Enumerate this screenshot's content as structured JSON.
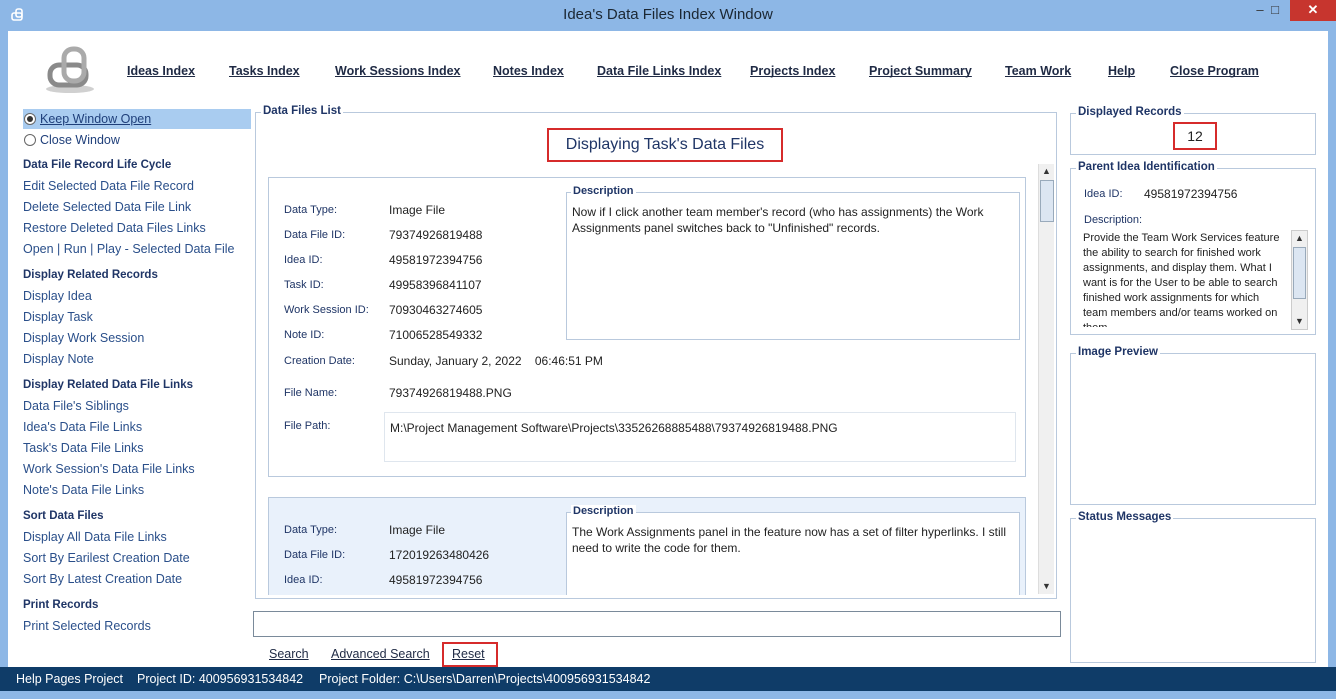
{
  "window": {
    "title": "Idea's Data Files Index Window",
    "min": "–",
    "max": "□",
    "close": "✕"
  },
  "nav": [
    "Ideas Index",
    "Tasks Index",
    "Work Sessions Index",
    "Notes Index",
    "Data File Links Index",
    "Projects Index",
    "Project Summary",
    "Team Work",
    "Help",
    "Close Program"
  ],
  "sidebar": {
    "keep_open": "Keep Window Open",
    "close_window": "Close Window",
    "sections": [
      {
        "title": "Data File Record Life Cycle",
        "links": [
          "Edit Selected Data File Record",
          "Delete Selected Data File Link",
          "Restore Deleted Data Files Links",
          "Open | Run | Play - Selected Data File"
        ]
      },
      {
        "title": "Display Related Records",
        "links": [
          "Display Idea",
          "Display Task",
          "Display Work Session",
          "Display Note"
        ]
      },
      {
        "title": "Display Related Data File Links",
        "links": [
          "Data File's Siblings",
          "Idea's Data File Links",
          "Task's Data File Links",
          "Work Session's Data File Links",
          "Note's Data File Links"
        ]
      },
      {
        "title": "Sort Data Files",
        "links": [
          "Display All Data File Links",
          "Sort By Earilest Creation Date",
          "Sort By Latest Creation Date"
        ]
      },
      {
        "title": "Print Records",
        "links": [
          "Print Selected Records"
        ]
      }
    ]
  },
  "data_files": {
    "group_title": "Data Files List",
    "heading": "Displaying Task's Data Files",
    "labels": {
      "data_type": "Data Type:",
      "data_file_id": "Data File ID:",
      "idea_id": "Idea ID:",
      "task_id": "Task ID:",
      "work_session_id": "Work Session ID:",
      "note_id": "Note ID:",
      "creation_date": "Creation Date:",
      "file_name": "File Name:",
      "file_path": "File Path:",
      "description": "Description"
    },
    "records": [
      {
        "data_type": "Image File",
        "data_file_id": "79374926819488",
        "idea_id": "49581972394756",
        "task_id": "49958396841107",
        "work_session_id": "70930463274605",
        "note_id": "71006528549332",
        "creation_date": "Sunday, January 2, 2022    06:46:51 PM",
        "file_name": "79374926819488.PNG",
        "file_path": "M:\\Project Management Software\\Projects\\33526268885488\\79374926819488.PNG",
        "description": "Now if I click another team member's record (who has assignments) the Work Assignments panel switches back to \"Unfinished\" records."
      },
      {
        "data_type": "Image File",
        "data_file_id": "172019263480426",
        "idea_id": "49581972394756",
        "description": "The Work Assignments panel in the feature now has a set of filter hyperlinks. I still need to write the code for them."
      }
    ]
  },
  "search": {
    "value": "",
    "search_label": "Search",
    "advanced_label": "Advanced Search",
    "reset_label": "Reset"
  },
  "right": {
    "displayed_records_title": "Displayed Records",
    "displayed_records_count": "12",
    "parent_title": "Parent Idea Identification",
    "idea_id_label": "Idea ID:",
    "idea_id_value": "49581972394756",
    "description_label": "Description:",
    "description_text": "Provide the Team Work Services feature the ability to search for finished work assignments, and display them. What I want is for the User to be able to search finished work assignments for which team members and/or teams worked on them",
    "image_preview_title": "Image Preview",
    "status_title": "Status Messages"
  },
  "statusbar": {
    "project": "Help Pages Project",
    "project_id": "Project ID:  400956931534842",
    "project_folder": "Project Folder:  C:\\Users\\Darren\\Projects\\400956931534842"
  }
}
